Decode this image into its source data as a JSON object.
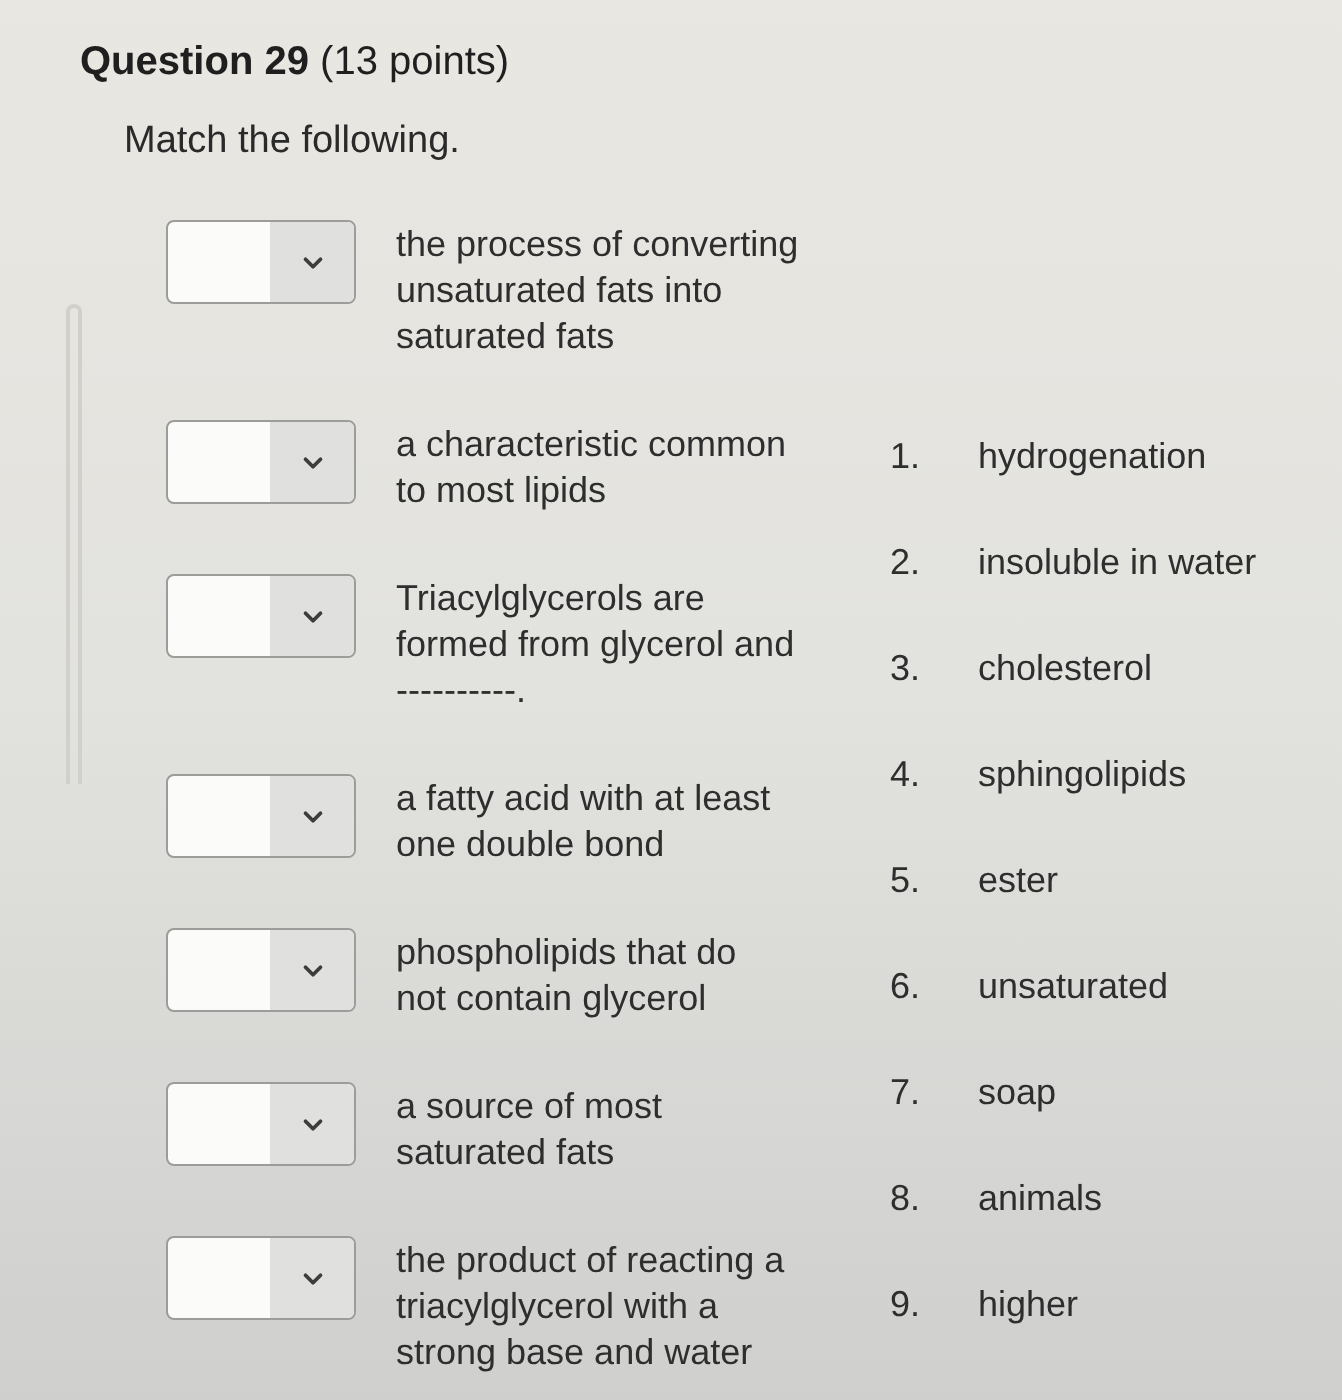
{
  "question": {
    "title": "**Question 29** (13 points)",
    "instruction": "Match the following."
  },
  "prompts": [
    {
      "text": "the process of converting\nunsaturated fats into\nsaturated fats"
    },
    {
      "text": "a characteristic common\nto most lipids"
    },
    {
      "text": "Triacylglycerols are\nformed from glycerol and\n----------."
    },
    {
      "text": "a fatty acid with at least\none double bond"
    },
    {
      "text": "phospholipids that do\nnot contain glycerol"
    },
    {
      "text": "a source of most\nsaturated fats"
    },
    {
      "text": "the product of reacting a\ntriacylglycerol with a\nstrong base and water"
    }
  ],
  "answers": [
    {
      "number": "1.",
      "text": "hydrogenation"
    },
    {
      "number": "2.",
      "text": "insoluble in water"
    },
    {
      "number": "3.",
      "text": "cholesterol"
    },
    {
      "number": "4.",
      "text": "sphingolipids"
    },
    {
      "number": "5.",
      "text": "ester"
    },
    {
      "number": "6.",
      "text": "unsaturated"
    },
    {
      "number": "7.",
      "text": "soap"
    },
    {
      "number": "8.",
      "text": "animals"
    },
    {
      "number": "9.",
      "text": "higher"
    }
  ]
}
